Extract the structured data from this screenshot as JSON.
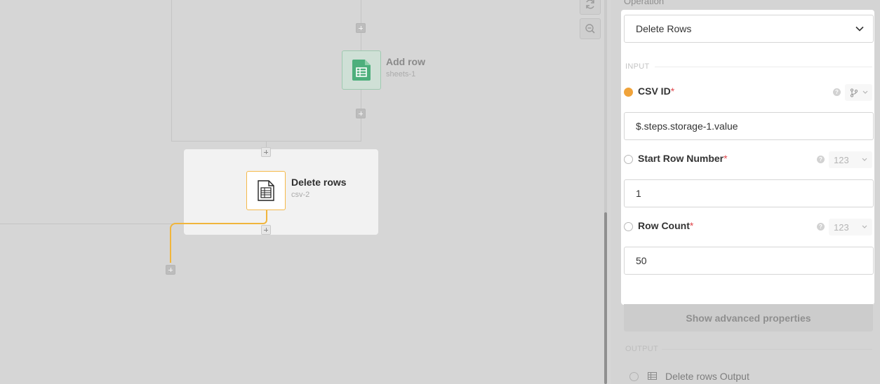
{
  "canvas": {
    "nodes": [
      {
        "title": "Add row",
        "subtitle": "sheets-1",
        "icon": "google-sheets-icon",
        "color": "#4daf7c"
      },
      {
        "title": "Delete rows",
        "subtitle": "csv-2",
        "icon": "csv-file-icon",
        "border_color": "#f5b94a"
      }
    ],
    "toolbar": {
      "refresh_icon": "refresh-icon",
      "zoom_icon": "zoom-out-icon"
    },
    "connector_color": "#f0b53c"
  },
  "panel": {
    "operation_label": "Operation",
    "operation_value": "Delete Rows",
    "input_section": "INPUT",
    "output_section": "OUTPUT",
    "properties": [
      {
        "label": "CSV ID",
        "required_mark": "*",
        "type": "branch-icon",
        "value": "$.steps.storage-1.value",
        "status": "set"
      },
      {
        "label": "Start Row Number",
        "required_mark": "*",
        "type": "123",
        "value": "1",
        "status": "unset"
      },
      {
        "label": "Row Count",
        "required_mark": "*",
        "type": "123",
        "value": "50",
        "status": "unset"
      }
    ],
    "help_glyph": "?",
    "advanced_button": "Show advanced properties",
    "output_item": "Delete rows Output",
    "accent": "#f0a33a",
    "required_color": "#e0464b"
  }
}
